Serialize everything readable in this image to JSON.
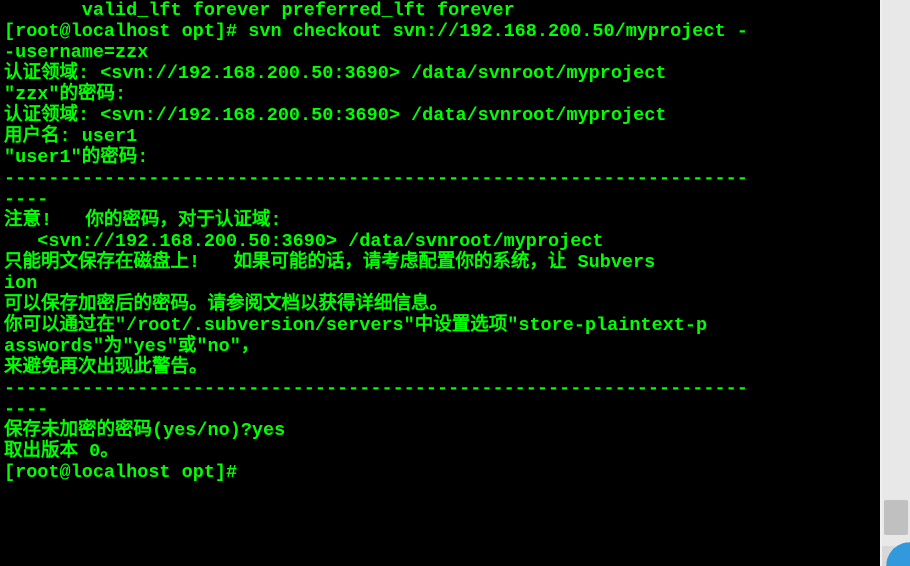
{
  "terminal": {
    "lines": [
      "       valid_lft forever preferred_lft forever",
      "[root@localhost opt]# svn checkout svn://192.168.200.50/myproject -",
      "-username=zzx",
      "认证领域: <svn://192.168.200.50:3690> /data/svnroot/myproject",
      "\"zzx\"的密码:",
      "认证领域: <svn://192.168.200.50:3690> /data/svnroot/myproject",
      "用户名: user1",
      "\"user1\"的密码:",
      "",
      "-------------------------------------------------------------------",
      "----",
      "注意!   你的密码，对于认证域:",
      "",
      "   <svn://192.168.200.50:3690> /data/svnroot/myproject",
      "",
      "只能明文保存在磁盘上!   如果可能的话，请考虑配置你的系统，让 Subvers",
      "ion",
      "可以保存加密后的密码。请参阅文档以获得详细信息。",
      "",
      "你可以通过在\"/root/.subversion/servers\"中设置选项\"store-plaintext-p",
      "asswords\"为\"yes\"或\"no\"，",
      "来避免再次出现此警告。",
      "-------------------------------------------------------------------",
      "----",
      "保存未加密的密码(yes/no)?yes",
      "取出版本 0。",
      "[root@localhost opt]# "
    ]
  }
}
